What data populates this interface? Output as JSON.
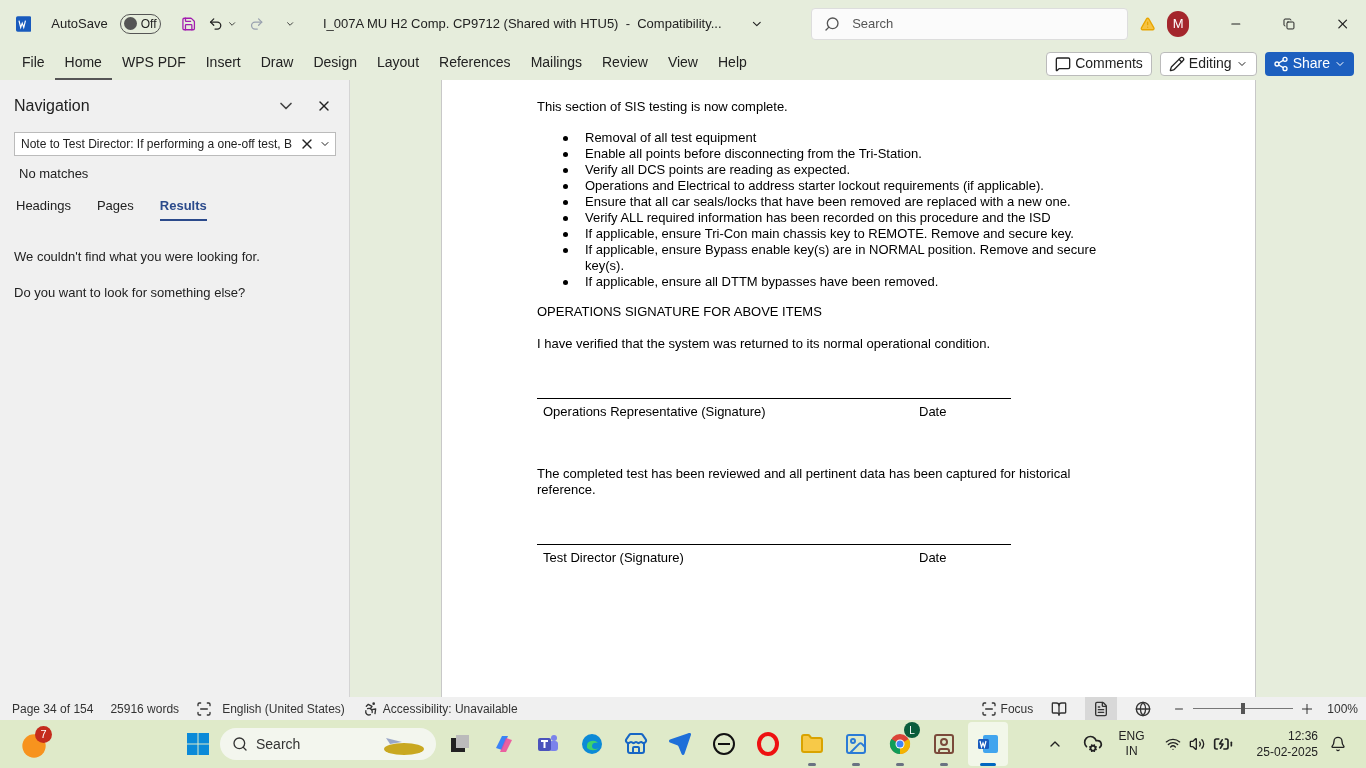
{
  "titlebar": {
    "autosave_label": "AutoSave",
    "autosave": {
      "label": "Off",
      "on": false
    },
    "document_title": "I_007A MU H2 Comp. CP9712 (Shared with HTU5)  -  Compatibility...",
    "search_placeholder": "Search",
    "avatar": "M"
  },
  "ribbon_tabs": [
    {
      "label": "File",
      "selected": false
    },
    {
      "label": "Home",
      "selected": true
    },
    {
      "label": "WPS PDF",
      "selected": false
    },
    {
      "label": "Insert",
      "selected": false
    },
    {
      "label": "Draw",
      "selected": false
    },
    {
      "label": "Design",
      "selected": false
    },
    {
      "label": "Layout",
      "selected": false
    },
    {
      "label": "References",
      "selected": false
    },
    {
      "label": "Mailings",
      "selected": false
    },
    {
      "label": "Review",
      "selected": false
    },
    {
      "label": "View",
      "selected": false
    },
    {
      "label": "Help",
      "selected": false
    }
  ],
  "ribbon_buttons": {
    "comments": "Comments",
    "editing": "Editing",
    "share": "Share"
  },
  "navigation": {
    "title": "Navigation",
    "search_value": "Note to Test Director: If performing a one-off test, B",
    "status": "No matches",
    "tabs": [
      {
        "label": "Headings",
        "selected": false
      },
      {
        "label": "Pages",
        "selected": false
      },
      {
        "label": "Results",
        "selected": true
      }
    ],
    "messages": [
      "We couldn't find what you were looking for.",
      "Do you want to look for something else?"
    ]
  },
  "document": {
    "intro": "This section of SIS testing is now complete.",
    "bullets": [
      "Removal of all test equipment",
      "Enable all points before disconnecting from the Tri-Station.",
      "Verify all DCS points are reading as expected.",
      "Operations and Electrical to address starter lockout requirements (if applicable).",
      "Ensure that all car seals/locks that have been removed are replaced with a new one.",
      "Verify ALL required information has been recorded on this procedure and the ISD",
      "If applicable, ensure Tri-Con main chassis key to REMOTE. Remove and secure key.",
      "If applicable, ensure Bypass enable key(s) are in NORMAL position. Remove and secure key(s).",
      "If applicable, ensure all DTTM bypasses have been removed."
    ],
    "ops_heading": "OPERATIONS SIGNATURE FOR ABOVE ITEMS",
    "blocks": [
      {
        "text": "I have verified that the system was returned to its normal operational condition.",
        "signer": "Operations Representative (Signature)",
        "date": "Date"
      },
      {
        "text": "The completed test has been reviewed and all pertinent data has been captured for historical reference.",
        "signer": "Test Director (Signature)",
        "date": "Date"
      }
    ]
  },
  "status_bar": {
    "page": "Page 34 of 154",
    "words": "25916 words",
    "language": "English (United States)",
    "accessibility": "Accessibility: Unavailable",
    "focus": "Focus",
    "views": [
      {
        "kind": "read",
        "selected": false
      },
      {
        "kind": "print",
        "selected": true
      },
      {
        "kind": "web",
        "selected": false
      }
    ],
    "zoom": {
      "level": 0.5,
      "reading": "100%"
    }
  },
  "taskbar": {
    "weather_badge": "7",
    "search_placeholder": "Search",
    "apps": [
      {
        "kind": "taskview",
        "running": false,
        "active": false
      },
      {
        "kind": "copilot",
        "running": false,
        "active": false
      },
      {
        "kind": "teams",
        "running": false,
        "active": false
      },
      {
        "kind": "edge",
        "running": false,
        "active": false
      },
      {
        "kind": "store",
        "running": false,
        "active": false
      },
      {
        "kind": "arrow",
        "running": false,
        "active": false
      },
      {
        "kind": "dell",
        "running": false,
        "active": false
      },
      {
        "kind": "opera",
        "running": false,
        "active": false
      },
      {
        "kind": "folder",
        "running": true,
        "active": false
      },
      {
        "kind": "photos",
        "running": true,
        "active": false
      },
      {
        "kind": "chrome",
        "running": true,
        "active": false,
        "badge": "L"
      },
      {
        "kind": "viewer",
        "running": true,
        "active": false
      },
      {
        "kind": "word",
        "running": true,
        "active": true
      }
    ],
    "language": [
      "ENG",
      "IN"
    ],
    "time": "12:36",
    "date": "25-02-2025"
  }
}
